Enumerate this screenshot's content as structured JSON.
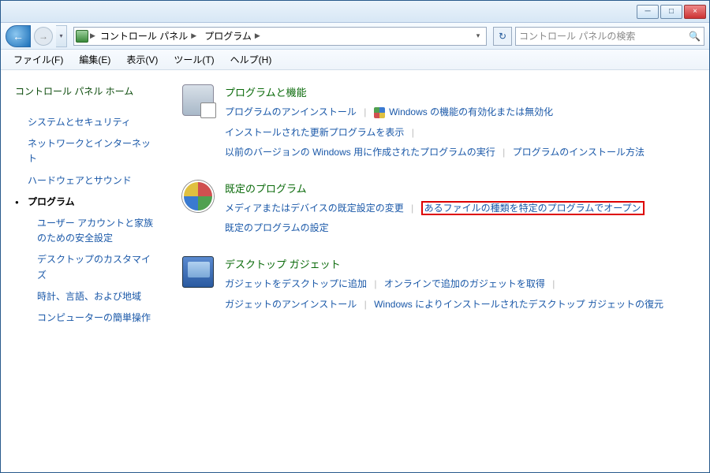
{
  "titlebar": {
    "min": "─",
    "max": "□",
    "close": "×"
  },
  "nav": {
    "back": "←",
    "fwd": "→",
    "breadcrumb": [
      "コントロール パネル",
      "プログラム"
    ],
    "refresh": "↻",
    "search_placeholder": "コントロール パネルの検索"
  },
  "menu": {
    "file": "ファイル(F)",
    "edit": "編集(E)",
    "view": "表示(V)",
    "tools": "ツール(T)",
    "help": "ヘルプ(H)"
  },
  "sidebar": {
    "home": "コントロール パネル ホーム",
    "items": [
      {
        "label": "システムとセキュリティ",
        "current": false
      },
      {
        "label": "ネットワークとインターネット",
        "current": false
      },
      {
        "label": "ハードウェアとサウンド",
        "current": false
      },
      {
        "label": "プログラム",
        "current": true
      },
      {
        "label": "ユーザー アカウントと家族のための安全設定",
        "current": false,
        "sub": true
      },
      {
        "label": "デスクトップのカスタマイズ",
        "current": false,
        "sub": true
      },
      {
        "label": "時計、言語、および地域",
        "current": false,
        "sub": true
      },
      {
        "label": "コンピューターの簡単操作",
        "current": false,
        "sub": true
      }
    ]
  },
  "sections": {
    "programs": {
      "title": "プログラムと機能",
      "uninstall": "プログラムのアンインストール",
      "features": "Windows の機能の有効化または無効化",
      "updates": "インストールされた更新プログラムを表示",
      "legacy": "以前のバージョンの Windows 用に作成されたプログラムの実行",
      "howto": "プログラムのインストール方法"
    },
    "defaults": {
      "title": "既定のプログラム",
      "media": "メディアまたはデバイスの既定設定の変更",
      "filetype": "あるファイルの種類を特定のプログラムでオープン",
      "settings": "既定のプログラムの設定"
    },
    "gadgets": {
      "title": "デスクトップ ガジェット",
      "add": "ガジェットをデスクトップに追加",
      "online": "オンラインで追加のガジェットを取得",
      "uninstall": "ガジェットのアンインストール",
      "restore": "Windows によりインストールされたデスクトップ ガジェットの復元"
    }
  }
}
